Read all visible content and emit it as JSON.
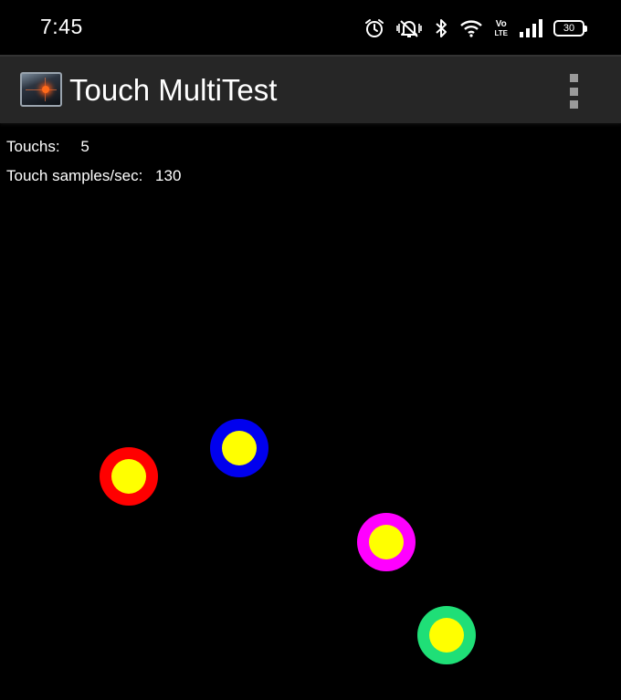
{
  "status_bar": {
    "time": "7:45",
    "battery_level": "30",
    "icons": [
      "alarm-icon",
      "mute-vibrate-icon",
      "bluetooth-icon",
      "wifi-icon",
      "volte-icon",
      "signal-icon",
      "battery-icon"
    ],
    "volte_label_top": "Vo",
    "volte_label_bottom": "LTE"
  },
  "app_bar": {
    "title": "Touch MultiTest",
    "icon": "app-crosshair-icon",
    "menu_icon": "overflow-menu-icon"
  },
  "info": {
    "touches_label": "Touchs:",
    "touches_value": "5",
    "samples_label": "Touch samples/sec:",
    "samples_value": "130"
  },
  "touch_points": [
    {
      "id": "red",
      "ring_color": "#ff0000",
      "inner_color": "#ffff00"
    },
    {
      "id": "blue",
      "ring_color": "#0000ee",
      "inner_color": "#ffff00"
    },
    {
      "id": "magenta",
      "ring_color": "#ff00ff",
      "inner_color": "#ffff00"
    },
    {
      "id": "green",
      "ring_color": "#1fdf77",
      "inner_color": "#ffff00"
    }
  ],
  "colors": {
    "background": "#000000",
    "app_bar": "#262626",
    "text": "#ffffff"
  }
}
